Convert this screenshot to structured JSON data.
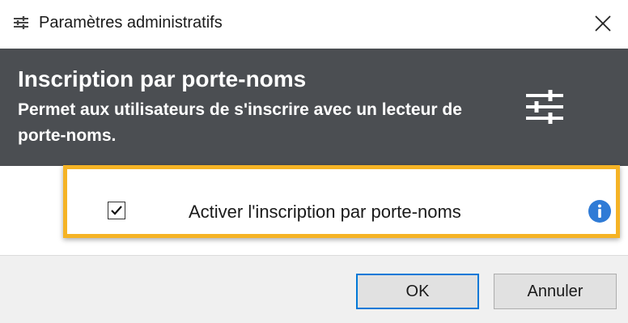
{
  "window": {
    "title": "Paramètres administratifs",
    "app_icon": "settings-sliders-icon",
    "close_icon": "close-icon"
  },
  "header": {
    "title": "Inscription par porte-noms",
    "description": "Permet aux utilisateurs de s'inscrire avec un lecteur de porte-noms.",
    "icon": "sliders-icon",
    "background_color": "#4b4e52"
  },
  "option": {
    "label": "Activer l'inscription par porte-noms",
    "checked": true,
    "info_icon": "info-icon",
    "highlight_color": "#f5b325"
  },
  "buttons": {
    "ok_label": "OK",
    "cancel_label": "Annuler"
  },
  "colors": {
    "accent": "#0078d7",
    "info": "#2f7bd6"
  }
}
